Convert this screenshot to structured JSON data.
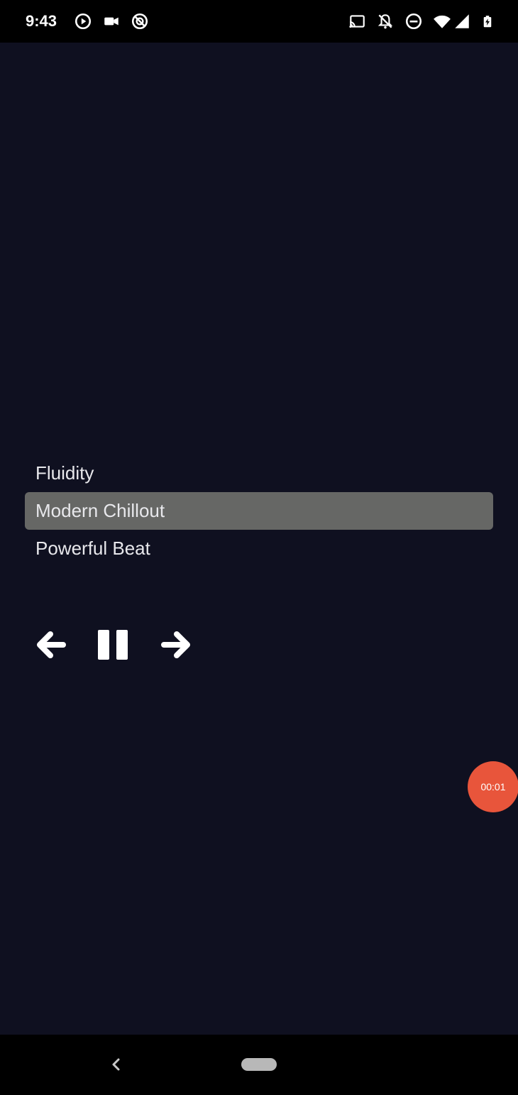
{
  "status_bar": {
    "time": "9:43",
    "left_icons": [
      "play-circle-icon",
      "video-camera-icon",
      "sync-disabled-icon"
    ],
    "right_icons": [
      "cast-icon",
      "notifications-off-icon",
      "do-not-disturb-icon",
      "wifi-icon",
      "signal-icon",
      "battery-charging-icon"
    ]
  },
  "tracks": [
    {
      "title": "Fluidity",
      "selected": false
    },
    {
      "title": "Modern Chillout",
      "selected": true
    },
    {
      "title": "Powerful Beat",
      "selected": false
    }
  ],
  "controls": {
    "previous_icon": "arrow-left-icon",
    "pause_icon": "pause-icon",
    "next_icon": "arrow-right-icon"
  },
  "recording": {
    "timer": "00:01",
    "color": "#e8553b"
  },
  "colors": {
    "background": "#0f1020",
    "selected_row": "#666765",
    "text": "#e8e8ec"
  },
  "nav_bar": {
    "back_icon": "back-chevron-icon",
    "home_icon": "home-pill-icon"
  }
}
